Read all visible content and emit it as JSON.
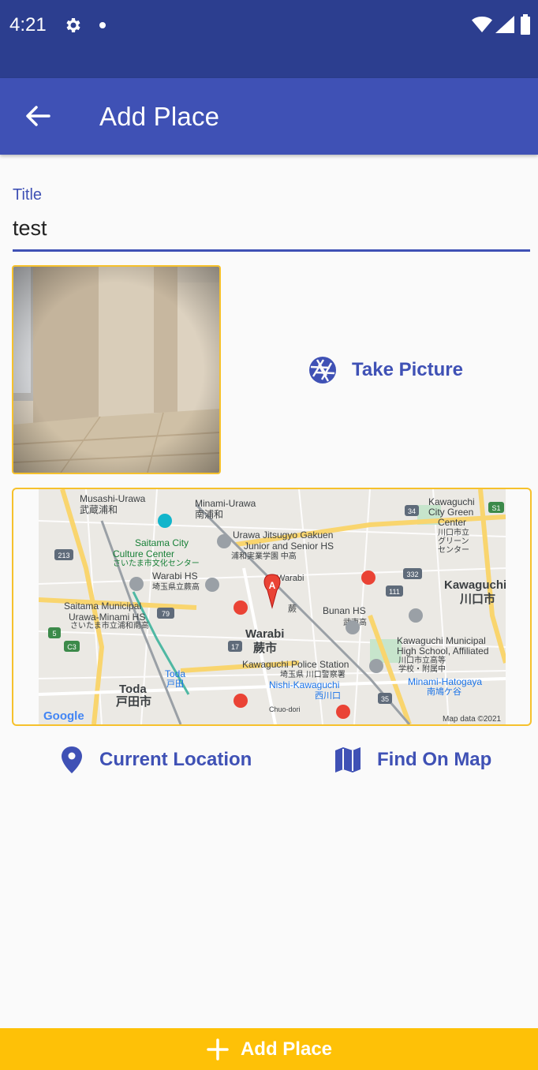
{
  "status_bar": {
    "time": "4:21"
  },
  "app_bar": {
    "title": "Add Place",
    "back_icon": "arrow-left-icon"
  },
  "title_field": {
    "label": "Title",
    "value": "test"
  },
  "photo": {
    "description_icon": "room-photo"
  },
  "take_picture": {
    "label": "Take Picture",
    "icon": "camera-aperture-icon"
  },
  "map": {
    "labels": {
      "musashi_urawa": "Musashi-Urawa",
      "musashi_urawa_jp": "武蔵浦和",
      "minami_urawa": "Minami-Urawa",
      "minami_urawa_jp": "南浦和",
      "kawaguchi_green": "Kawaguchi",
      "kawaguchi_green2": "City Green",
      "kawaguchi_green3": "Center",
      "kawaguchi_green_jp": "川口市立",
      "kawaguchi_green_jp2": "グリーン",
      "kawaguchi_green_jp3": "センター",
      "saitama_culture1": "Saitama City",
      "saitama_culture2": "Culture Center",
      "saitama_culture_jp": "さいたま市文化センター",
      "urawa_jitsugyo1": "Urawa Jitsugyo Gakuen",
      "urawa_jitsugyo2": "Junior and Senior HS",
      "urawa_jitsugyo_jp": "浦和実業学園 中高",
      "warabi_hs": "Warabi HS",
      "warabi_hs_jp": "埼玉県立蕨高",
      "warabi_station": "Warabi",
      "warabi_station_jp": "蕨",
      "kawaguchi_city": "Kawaguchi",
      "kawaguchi_city_jp": "川口市",
      "saitama_muni1": "Saitama Municipal",
      "saitama_muni2": "Urawa-Minami HS",
      "saitama_muni_jp": "さいたま市立浦和南高",
      "bunan_hs": "Bunan HS",
      "bunan_hs_jp": "武南高",
      "warabi_city": "Warabi",
      "warabi_city_jp": "蕨市",
      "kawaguchi_muni1": "Kawaguchi Municipal",
      "kawaguchi_muni2": "High School, Affiliated",
      "kawaguchi_muni_jp": "川口市立高等",
      "kawaguchi_muni_jp2": "学校・附属中",
      "police1": "Kawaguchi Police Station",
      "police_jp": "埼玉県 川口警察署",
      "toda_station": "Toda",
      "toda_station_jp": "戸田",
      "nishi_kawaguchi": "Nishi-Kawaguchi",
      "nishi_kawaguchi_jp": "西川口",
      "minami_hatogaya": "Minami-Hatogaya",
      "minami_hatogaya_jp": "南鳩ケ谷",
      "toda_city": "Toda",
      "toda_city_jp": "戸田市",
      "chuo_dori": "Chuo-dori",
      "google": "Google",
      "map_data": "Map data ©2021",
      "marker": "A",
      "road_213": "213",
      "road_79": "79",
      "road_17": "17",
      "road_5": "5",
      "road_c3": "C3",
      "road_34": "34",
      "road_111": "111",
      "road_332": "332",
      "road_35": "35",
      "road_s1": "S1"
    }
  },
  "current_location": {
    "label": "Current Location",
    "icon": "location-pin-icon"
  },
  "find_on_map": {
    "label": "Find On Map",
    "icon": "map-icon"
  },
  "add_place_button": {
    "label": "Add Place",
    "icon": "plus-icon"
  },
  "colors": {
    "primary": "#3f51b5",
    "primary_dark": "#2c3e8f",
    "accent": "#fec107",
    "frame": "#f6c12c"
  }
}
